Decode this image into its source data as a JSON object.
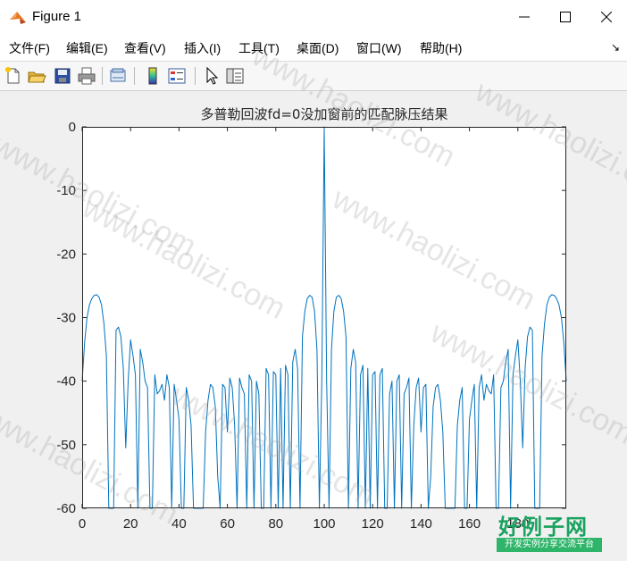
{
  "window": {
    "title": "Figure 1",
    "controls": {
      "minimize_icon": "minimize-icon",
      "maximize_icon": "maximize-icon",
      "close_icon": "close-icon"
    }
  },
  "menu": {
    "items": [
      "文件(F)",
      "编辑(E)",
      "查看(V)",
      "插入(I)",
      "工具(T)",
      "桌面(D)",
      "窗口(W)",
      "帮助(H)"
    ],
    "dock_arrow": "↘"
  },
  "toolbar": {
    "icons": [
      "new-figure-icon",
      "open-file-icon",
      "save-icon",
      "print-icon",
      "link-plot-icon",
      "insert-colorbar-icon",
      "insert-legend-icon",
      "pointer-icon",
      "property-inspector-icon"
    ]
  },
  "chart_data": {
    "type": "line",
    "title": "多普勒回波fd=0没加窗前的匹配脉压结果",
    "xlabel": "",
    "ylabel": "",
    "xlim": [
      0,
      200
    ],
    "ylim": [
      -60,
      0
    ],
    "xticks": [
      0,
      20,
      40,
      60,
      80,
      100,
      120,
      140,
      160,
      180
    ],
    "yticks": [
      0,
      -10,
      -20,
      -30,
      -40,
      -50,
      -60
    ],
    "grid": false,
    "line_color": "#0072bd",
    "series": [
      {
        "x": [
          0,
          1,
          2,
          3,
          4,
          5,
          6,
          7,
          8,
          9,
          10,
          11,
          12,
          13,
          14,
          15,
          16,
          17,
          18,
          19,
          20,
          21,
          22,
          23,
          24,
          25,
          26,
          27,
          28,
          29,
          30,
          31,
          32,
          33,
          34,
          35,
          36,
          37,
          38,
          39,
          40,
          41,
          42,
          43,
          44,
          45,
          46,
          47,
          48,
          49,
          50,
          51,
          52,
          53,
          54,
          55,
          56,
          57,
          58,
          59,
          60,
          61,
          62,
          63,
          64,
          65,
          66,
          67,
          68,
          69,
          70,
          71,
          72,
          73,
          74,
          75,
          76,
          77,
          78,
          79,
          80,
          81,
          82,
          83,
          84,
          85,
          86,
          87,
          88,
          89,
          90,
          91,
          92,
          93,
          94,
          95,
          96,
          97,
          98,
          99,
          100,
          101,
          102,
          103,
          104,
          105,
          106,
          107,
          108,
          109,
          110,
          111,
          112,
          113,
          114,
          115,
          116,
          117,
          118,
          119,
          120,
          121,
          122,
          123,
          124,
          125,
          126,
          127,
          128,
          129,
          130,
          131,
          132,
          133,
          134,
          135,
          136,
          137,
          138,
          139,
          140,
          141,
          142,
          143,
          144,
          145,
          146,
          147,
          148,
          149,
          150,
          151,
          152,
          153,
          154,
          155,
          156,
          157,
          158,
          159,
          160,
          161,
          162,
          163,
          164,
          165,
          166,
          167,
          168,
          169,
          170,
          171,
          172,
          173,
          174,
          175,
          176,
          177,
          178,
          179,
          180,
          181,
          182,
          183,
          184,
          185,
          186,
          187,
          188,
          189,
          190,
          191,
          192,
          193,
          194,
          195,
          196,
          197,
          198,
          199,
          200
        ],
        "y": [
          -40,
          -34,
          -30,
          -28,
          -27,
          -26.5,
          -26.4,
          -26.8,
          -28,
          -31,
          -36,
          -60,
          -60,
          -60,
          -32,
          -31.5,
          -33,
          -38,
          -50.5,
          -40,
          -33.5,
          -36,
          -39,
          -60,
          -35,
          -37,
          -40,
          -41,
          -60,
          -60,
          -39,
          -42,
          -41.5,
          -40.5,
          -43,
          -39,
          -41,
          -60,
          -40.5,
          -43,
          -46,
          -60,
          -60,
          -41,
          -43,
          -47,
          -60,
          -60,
          -60,
          -60,
          -60,
          -48,
          -43,
          -40.5,
          -41,
          -44,
          -55,
          -60,
          -40.5,
          -41,
          -48,
          -39.5,
          -41,
          -47,
          -60,
          -39.5,
          -41,
          -42,
          -60,
          -39,
          -40,
          -60,
          -40,
          -42,
          -60,
          -60,
          -38,
          -39,
          -60,
          -38.5,
          -39,
          -60,
          -38,
          -60,
          -37.5,
          -39,
          -60,
          -37,
          -35,
          -38,
          -60,
          -33,
          -29,
          -27,
          -26.5,
          -26.8,
          -29,
          -35,
          -60,
          -40,
          0,
          -40,
          -60,
          -35,
          -29,
          -26.8,
          -26.5,
          -27,
          -29,
          -33,
          -60,
          -38,
          -35,
          -37,
          -60,
          -39,
          -37.5,
          -60,
          -38,
          -60,
          -39,
          -38.5,
          -60,
          -39,
          -38,
          -60,
          -60,
          -42,
          -40,
          -60,
          -40,
          -39,
          -60,
          -42,
          -41,
          -39.5,
          -60,
          -47,
          -41,
          -39.5,
          -48,
          -41,
          -40.5,
          -60,
          -55,
          -44,
          -41,
          -40.5,
          -43,
          -48,
          -60,
          -60,
          -60,
          -60,
          -60,
          -47,
          -43,
          -41,
          -60,
          -60,
          -46,
          -43,
          -40.5,
          -60,
          -41,
          -39,
          -43,
          -40.5,
          -41.5,
          -42,
          -39,
          -60,
          -60,
          -41,
          -40,
          -37,
          -35,
          -60,
          -39,
          -36,
          -33.5,
          -40,
          -50.5,
          -38,
          -33,
          -31.5,
          -32,
          -60,
          -60,
          -60,
          -36,
          -31,
          -28,
          -26.8,
          -26.4,
          -26.5,
          -27,
          -28,
          -30,
          -34,
          -40
        ]
      }
    ]
  },
  "watermark": {
    "text": "www.haolizi.com",
    "logo_main": "好例子网",
    "logo_sub": "开发实例分享交流平台"
  }
}
